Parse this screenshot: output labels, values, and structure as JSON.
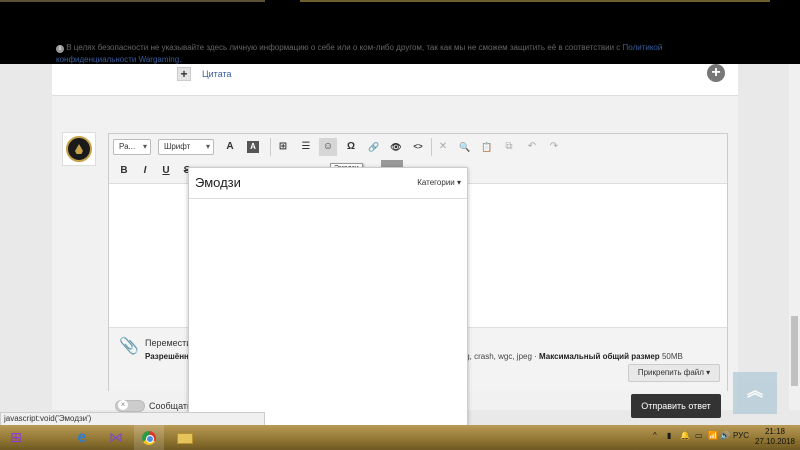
{
  "quote_row": {
    "plus_label": "+",
    "quote_label": "Цитата",
    "add_label": "+"
  },
  "notice": {
    "text": "В целях безопасности не указывайте здесь личную информацию о себе или о ком-либо другом, так как мы не сможем защитить её в соответствии с",
    "link": "Политикой конфиденциальности Wargaming",
    "end": "."
  },
  "toolbar": {
    "size_dd": "Ра...",
    "font_dd": "Шрифт",
    "row1": [
      "A",
      "A",
      "⊞",
      "☰",
      "☺",
      "Ω",
      "🔗",
      "👁",
      "<>",
      "✕",
      "🔍",
      "📋",
      "⧉",
      "↶",
      "↷"
    ],
    "row2": [
      "B",
      "I",
      "U",
      "S"
    ]
  },
  "tooltip": {
    "emoji": "Эмодзи"
  },
  "emoji_panel": {
    "title": "Эмодзи",
    "categories": "Категории ▾"
  },
  "attachments": {
    "move_text": "Перемести",
    "allowed_label": "Разрешённ",
    "allowed_tail": "log, crash, wgc, jpeg ·",
    "max_label": "Максимальный общий размер",
    "max_value": "50MB",
    "attach_button": "Прикрепить файл ▾"
  },
  "footer": {
    "toggle_label": "Сообщать",
    "send_button": "Отправить ответ"
  },
  "status_url": "javascript:void('Эмодзи')",
  "taskbar": {
    "lang": "РУС",
    "time": "21:18",
    "date": "27.10.2018",
    "tray_icons": [
      "^",
      "▮",
      "🔔",
      "▭",
      "📶",
      "🔊"
    ]
  },
  "colors": {
    "link": "#3a5d9c",
    "send_button_bg": "#333333",
    "back_to_top": "#b8cfd9",
    "taskbar": "#8f7432"
  }
}
